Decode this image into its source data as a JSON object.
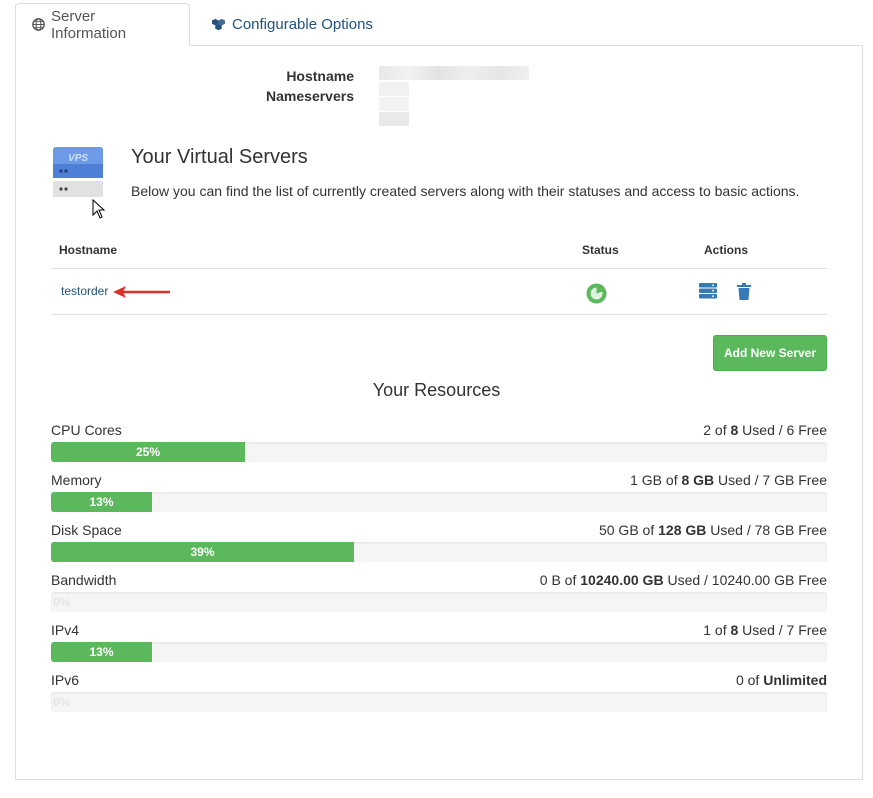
{
  "tabs": [
    {
      "label": "Server Information",
      "icon": "globe-icon",
      "active": true
    },
    {
      "label": "Configurable Options",
      "icon": "cubes-icon",
      "active": false
    }
  ],
  "server_info": {
    "hostname_label": "Hostname",
    "nameservers_label": "Nameservers"
  },
  "vps": {
    "icon_text": "VPS",
    "title": "Your Virtual Servers",
    "description": "Below you can find the list of currently created servers along with their statuses and access to basic actions."
  },
  "table": {
    "headers": {
      "hostname": "Hostname",
      "status": "Status",
      "actions": "Actions"
    },
    "rows": [
      {
        "hostname": "testorder",
        "status_icon": "status-online-icon",
        "actions": [
          "server-manage-icon",
          "trash-icon"
        ]
      }
    ]
  },
  "add_button": "Add New Server",
  "resources": {
    "title": "Your Resources",
    "items": [
      {
        "name": "CPU Cores",
        "used": "2",
        "of": " of ",
        "total": "8",
        "rest": " Used / 6 Free",
        "percent": 25,
        "percent_label": "25%"
      },
      {
        "name": "Memory",
        "used": "1 GB",
        "of": " of ",
        "total": "8 GB",
        "rest": " Used / 7 GB Free",
        "percent": 13,
        "percent_label": "13%"
      },
      {
        "name": "Disk Space",
        "used": "50 GB",
        "of": " of ",
        "total": "128 GB",
        "rest": " Used / 78 GB Free",
        "percent": 39,
        "percent_label": "39%"
      },
      {
        "name": "Bandwidth",
        "used": "0 B",
        "of": " of ",
        "total": "10240.00 GB",
        "rest": " Used / 10240.00 GB Free",
        "percent": 0,
        "percent_label": "0%"
      },
      {
        "name": "IPv4",
        "used": "1",
        "of": " of ",
        "total": "8",
        "rest": " Used / 7 Free",
        "percent": 13,
        "percent_label": "13%"
      },
      {
        "name": "IPv6",
        "used": "0",
        "of": " of ",
        "total": "Unlimited",
        "rest": "",
        "percent": 0,
        "percent_label": "0%"
      }
    ]
  },
  "colors": {
    "accent_green": "#5cb85c",
    "link_blue": "#23527c",
    "icon_blue": "#337ab7",
    "arrow_red": "#d9302b"
  }
}
